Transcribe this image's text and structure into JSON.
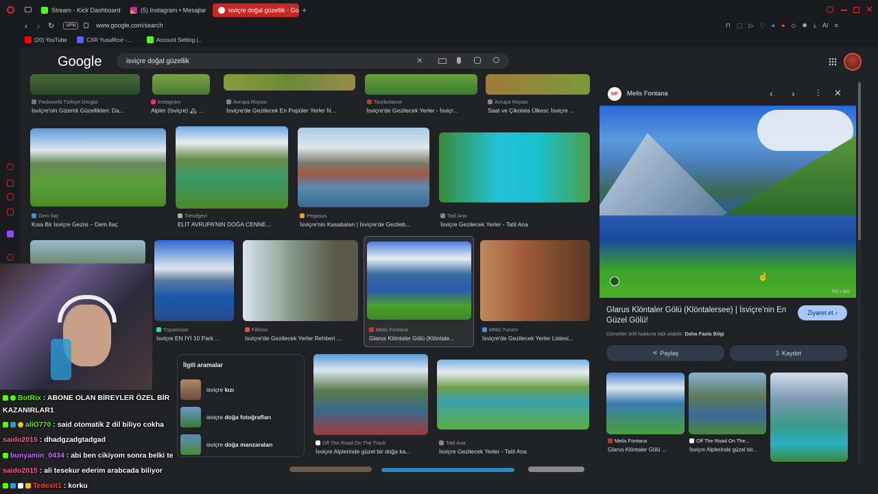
{
  "tabs": [
    {
      "label": "Stream - Kick Dashboard",
      "color": "#53fc18"
    },
    {
      "label": "(5) Instagram • Mesajlar",
      "color": "#e1306c"
    },
    {
      "label": "isviçre doğal güzellik - Goo",
      "color": "#ffffff"
    }
  ],
  "address": {
    "vpn": "VPN",
    "url": "www.google.com/search",
    "ai": "AI"
  },
  "bookmarks": [
    {
      "label": "(20) YouTube",
      "color": "#ff0000"
    },
    {
      "label": "CXR Yusuf#cxr -...",
      "color": "#5865f2"
    },
    {
      "label": "Account Setting |...",
      "color": "#53fc18"
    }
  ],
  "google": {
    "logo": "Google",
    "query": "isviçre doğal güzellik"
  },
  "row1": [
    {
      "source": "Packworld Türkiye Dergisi",
      "title": "İsviçre'nin Gizemli Güzellikleri: Da...",
      "color": "#5a7a3a"
    },
    {
      "source": "Instagram",
      "title": "Alpler (İsviçre) 🏔 ...",
      "color": "#6a8a4a"
    },
    {
      "source": "Avrupa Rüyası",
      "title": "İsviçre'de Gezilecek En Popüler Yerler N...",
      "color": "#7a9a3a"
    },
    {
      "source": "Tourbulance",
      "title": "İsviçre'de Gezilecek Yerler - İsviçr...",
      "color": "#6aa040"
    },
    {
      "source": "Avrupa Rüyası",
      "title": "Saat ve Çikolata Ülkesi: İsviçre ...",
      "color": "#8a7a3a"
    }
  ],
  "row2": [
    {
      "source": "Dem İlaç",
      "title": "Kısa Bir İsviçre Gezisi – Dem İlaç"
    },
    {
      "source": "Trendgezi",
      "title": "ELİT AVRUPA'NIN DOĞA CENNE..."
    },
    {
      "source": "Pegasus",
      "title": "İsviçre'nin Kasabaları | İsviçre'de Gezileb..."
    },
    {
      "source": "Tatil Ana",
      "title": "İsviçre Gezilecek Yerler - Tatil Ana"
    }
  ],
  "row3": [
    {
      "source": "",
      "title": ""
    },
    {
      "source": "Tripadvisor",
      "title": "İsviçre EN İYİ 10 Park ..."
    },
    {
      "source": "FilGezi",
      "title": "İsviçre'de Gezilecek Yerler Rehberi ..."
    },
    {
      "source": "Melis Fontana",
      "title": "Glarus Klöntaler Gölü (Klöntale..."
    },
    {
      "source": "MNG Turizm",
      "title": "İsviçre'de Gezilecek Yerler Listesi..."
    }
  ],
  "related": {
    "heading": "İlgili aramalar",
    "items": [
      {
        "prefix": "isviçre ",
        "bold": "kızı"
      },
      {
        "prefix": "isviçre ",
        "bold": "doğa fotoğrafları"
      },
      {
        "prefix": "isviçre ",
        "bold": "doğa manzaraları"
      }
    ]
  },
  "row4": [
    {
      "source": "Off The Road On The Track",
      "title": "İsviçre Alplerinde güzel bir doğa ka..."
    },
    {
      "source": "Tatil Ana",
      "title": "İsviçre Gezilecek Yerler - Tatil Ana"
    }
  ],
  "panel": {
    "site": "Melis Fontana",
    "site_initials": "MF",
    "image_size": "750 × 562",
    "title": "Glarus Klöntaler Gölü (Klöntalersee) | İsviçre'nin En Güzel Gölü!",
    "visit": "Ziyaret et",
    "copyright": "Görseller telif hakkına tabi olabilir.",
    "more_info": "Daha Fazla Bilgi",
    "share": "Paylaş",
    "save": "Kaydet",
    "thumbs": [
      {
        "source": "Melis Fontana",
        "title": "Glarus Klöntaler Gölü ..."
      },
      {
        "source": "Off The Road On The...",
        "title": "İsviçre Alplerinde güzel bir..."
      },
      {
        "source": "",
        "title": ""
      }
    ]
  },
  "chat": [
    {
      "user": "BotRix",
      "user_color": "#53fc18",
      "msg": ": ABONE OLAN BİREYLER ÖZEL BİR"
    },
    {
      "user": "",
      "user_color": "#ffffff",
      "msg": "KAZANIRLAR1"
    },
    {
      "user": "aliO770",
      "user_color": "#53fc18",
      "msg": ": said otomatik 2 dil biliyo cokha"
    },
    {
      "user": "saido2015",
      "user_color": "#ff5e8a",
      "msg": ": dhadgzadgtadgad"
    },
    {
      "user": "bunyamin_0434",
      "user_color": "#d070ff",
      "msg": ": abi ben cikiyom sonra belki te"
    },
    {
      "user": "saido2015",
      "user_color": "#ff5e8a",
      "msg": ": ali tesekur ederim arabcada biliyor"
    },
    {
      "user": "Tedexit1",
      "user_color": "#ff4040",
      "msg": ": korku"
    }
  ]
}
